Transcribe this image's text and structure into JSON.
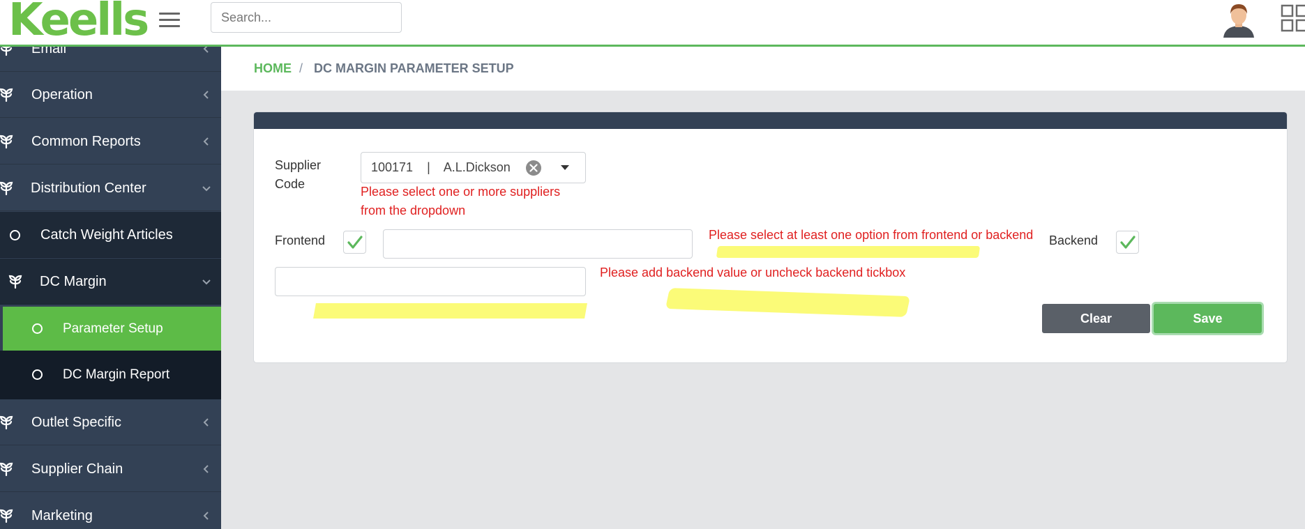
{
  "header": {
    "logo_text": "Keells",
    "search_placeholder": "Search..."
  },
  "sidebar": {
    "items": [
      {
        "label": "Email"
      },
      {
        "label": "Operation"
      },
      {
        "label": "Common Reports"
      },
      {
        "label": "Distribution Center"
      },
      {
        "label": "Catch Weight Articles"
      },
      {
        "label": "DC Margin"
      },
      {
        "label": "Parameter Setup"
      },
      {
        "label": "DC Margin Report"
      },
      {
        "label": "Outlet Specific"
      },
      {
        "label": "Supplier Chain"
      },
      {
        "label": "Marketing"
      }
    ]
  },
  "breadcrumb": {
    "home": "HOME",
    "separator": "/",
    "current": "DC MARGIN PARAMETER SETUP"
  },
  "form": {
    "supplier_label_line1": "Supplier",
    "supplier_label_line2": "Code",
    "supplier_selected": "100171    |    A.L.Dickson",
    "supplier_error_line1": "Please select one or more suppliers",
    "supplier_error_line2": "from the dropdown",
    "frontend_label": "Frontend",
    "frontend_checked": true,
    "frontend_value": "",
    "option_error": "Please select at least one option from frontend or backend",
    "backend_label": "Backend",
    "backend_checked": true,
    "backend_value": "",
    "backend_error": "Please add backend value or uncheck backend tickbox",
    "clear_label": "Clear",
    "save_label": "Save"
  },
  "colors": {
    "accent_green": "#5cb85c",
    "sidebar_bg": "#334155",
    "error_red": "#e02020",
    "highlight_yellow": "#fbfb78"
  }
}
